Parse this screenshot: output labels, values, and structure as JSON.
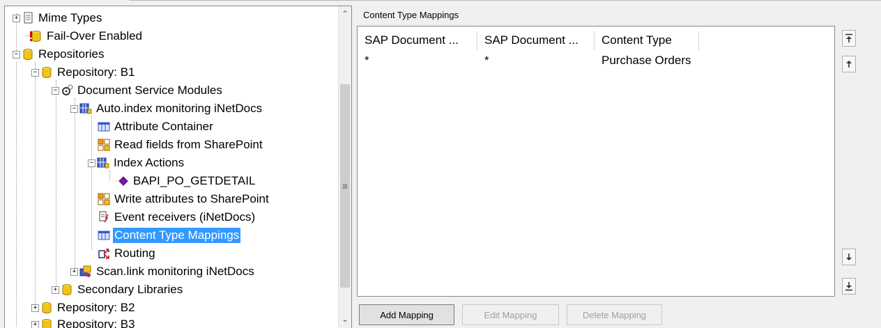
{
  "tree": {
    "items": [
      {
        "label": "Mime Types"
      },
      {
        "label": "Fail-Over Enabled"
      },
      {
        "label": "Repositories"
      },
      {
        "label": "Repository: B1"
      },
      {
        "label": "Document Service Modules"
      },
      {
        "label": "Auto.index monitoring iNetDocs"
      },
      {
        "label": "Attribute Container"
      },
      {
        "label": "Read fields from SharePoint"
      },
      {
        "label": "Index Actions"
      },
      {
        "label": "BAPI_PO_GETDETAIL"
      },
      {
        "label": "Write attributes to SharePoint"
      },
      {
        "label": "Event receivers (iNetDocs)"
      },
      {
        "label": "Content Type Mappings"
      },
      {
        "label": "Routing"
      },
      {
        "label": "Scan.link monitoring iNetDocs"
      },
      {
        "label": "Secondary Libraries"
      },
      {
        "label": "Repository: B2"
      },
      {
        "label": "Repository: B3"
      }
    ]
  },
  "mappings": {
    "title": "Content Type Mappings",
    "columns": [
      "SAP Document ...",
      "SAP Document ...",
      "Content Type"
    ],
    "rows": [
      [
        "*",
        "*",
        "Purchase Orders"
      ]
    ]
  },
  "buttons": {
    "add": "Add Mapping",
    "edit": "Edit Mapping",
    "delete": "Delete Mapping"
  },
  "colors": {
    "selection": "#3399ff",
    "db_yellow": "#f2c318",
    "module_blue": "#3e57c9"
  }
}
